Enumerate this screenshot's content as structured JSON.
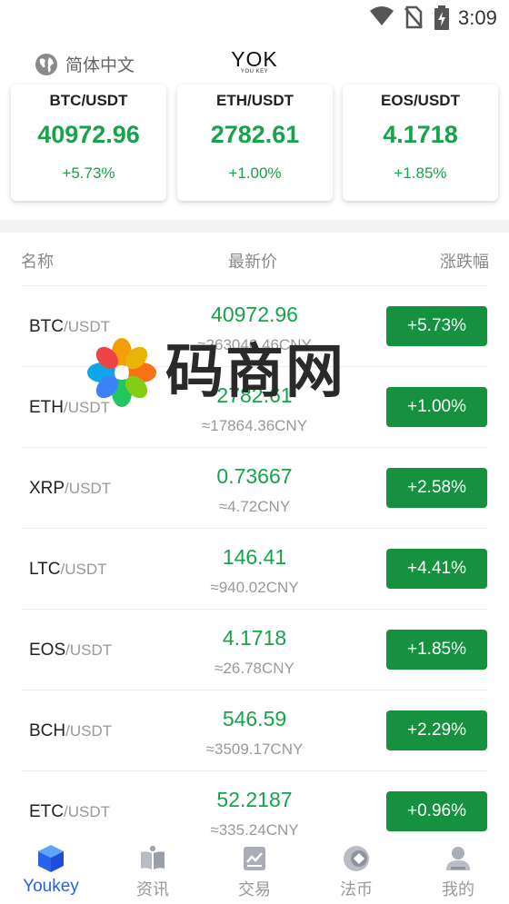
{
  "status_bar": {
    "time": "3:09"
  },
  "header": {
    "language_label": "简体中文",
    "logo_text": "YOK",
    "logo_sub": "YOU KEY"
  },
  "tickers": [
    {
      "pair": "BTC/USDT",
      "price": "40972.96",
      "change": "+5.73%"
    },
    {
      "pair": "ETH/USDT",
      "price": "2782.61",
      "change": "+1.00%"
    },
    {
      "pair": "EOS/USDT",
      "price": "4.1718",
      "change": "+1.85%"
    }
  ],
  "table": {
    "headers": {
      "name": "名称",
      "price": "最新价",
      "change": "涨跌幅"
    },
    "rows": [
      {
        "base": "BTC",
        "quote": "/USDT",
        "last": "40972.96",
        "cny": "≈263046.46CNY",
        "change": "+5.73%"
      },
      {
        "base": "ETH",
        "quote": "/USDT",
        "last": "2782.61",
        "cny": "≈17864.36CNY",
        "change": "+1.00%"
      },
      {
        "base": "XRP",
        "quote": "/USDT",
        "last": "0.73667",
        "cny": "≈4.72CNY",
        "change": "+2.58%"
      },
      {
        "base": "LTC",
        "quote": "/USDT",
        "last": "146.41",
        "cny": "≈940.02CNY",
        "change": "+4.41%"
      },
      {
        "base": "EOS",
        "quote": "/USDT",
        "last": "4.1718",
        "cny": "≈26.78CNY",
        "change": "+1.85%"
      },
      {
        "base": "BCH",
        "quote": "/USDT",
        "last": "546.59",
        "cny": "≈3509.17CNY",
        "change": "+2.29%"
      },
      {
        "base": "ETC",
        "quote": "/USDT",
        "last": "52.2187",
        "cny": "≈335.24CNY",
        "change": "+0.96%"
      }
    ]
  },
  "watermark": {
    "text": "码商网"
  },
  "bottom_nav": [
    {
      "label": "Youkey",
      "icon": "cube-icon",
      "active": true
    },
    {
      "label": "资讯",
      "icon": "book-icon",
      "active": false
    },
    {
      "label": "交易",
      "icon": "chart-icon",
      "active": false
    },
    {
      "label": "法币",
      "icon": "coin-icon",
      "active": false
    },
    {
      "label": "我的",
      "icon": "user-icon",
      "active": false
    }
  ],
  "colors": {
    "up_green": "#16a34a",
    "button_green": "#15913f",
    "active_blue": "#2563eb",
    "muted_grey": "#999999"
  }
}
